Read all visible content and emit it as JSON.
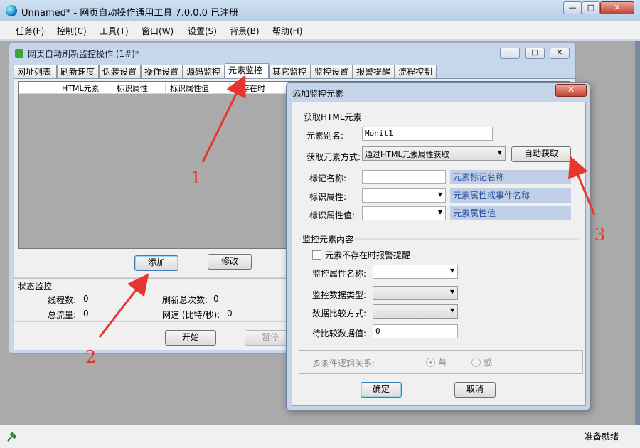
{
  "window": {
    "title": "Unnamed* - 网页自动操作通用工具 7.0.0.0 已注册",
    "min": "—",
    "max": "□",
    "close": "✕"
  },
  "menu": [
    "任务(F)",
    "控制(C)",
    "工具(T)",
    "窗口(W)",
    "设置(S)",
    "背景(B)",
    "帮助(H)"
  ],
  "child": {
    "title": "网页自动刷新监控操作 (1#)*",
    "tabs": [
      "网址列表",
      "刷新速度",
      "伪装设置",
      "操作设置",
      "源码监控",
      "元素监控",
      "其它监控",
      "监控设置",
      "报警提醒",
      "流程控制"
    ],
    "active_tab": "元素监控",
    "list_columns": [
      "HTML元素",
      "标识属性",
      "标识属性值",
      "不存在时"
    ],
    "add_button": "添加",
    "edit_button": "修改",
    "status": {
      "group_title": "状态监控",
      "threads_label": "线程数:",
      "threads_value": "0",
      "traffic_label": "总流量:",
      "traffic_value": "0",
      "refresh_label": "刷新总次数:",
      "refresh_value": "0",
      "speed_label": "网速 (比特/秒):",
      "speed_value": "0"
    },
    "start_button": "开始",
    "pause_button": "暂停"
  },
  "dialog": {
    "title": "添加监控元素",
    "close": "✕",
    "group1_title": "获取HTML元素",
    "alias_label": "元素别名:",
    "alias_value": "Monit1",
    "method_label": "获取元素方式:",
    "method_value": "通过HTML元素属性获取",
    "auto_button": "自动获取",
    "tag_label": "标记名称:",
    "tag_hint": "元素标记名称",
    "attr_label": "标识属性:",
    "attr_hint": "元素属性或事件名称",
    "attrval_label": "标识属性值:",
    "attrval_hint": "元素属性值",
    "group2_title": "监控元素内容",
    "notexist_label": "元素不存在时报警提醒",
    "mon_attr_label": "监控属性名称:",
    "data_type_label": "监控数据类型:",
    "compare_label": "数据比较方式:",
    "compare_value_label": "待比较数据值:",
    "compare_value": "0",
    "logic_label": "多条件逻辑关系:",
    "logic_and": "与",
    "logic_or": "或",
    "ok_button": "确定",
    "cancel_button": "取消"
  },
  "statusbar": {
    "text": "准备就绪"
  },
  "annotations": [
    "1",
    "2",
    "3"
  ],
  "colors": {
    "annotation": "#e8352f",
    "hint_bg": "#c0cfe6",
    "hint_text": "#244c9a"
  }
}
